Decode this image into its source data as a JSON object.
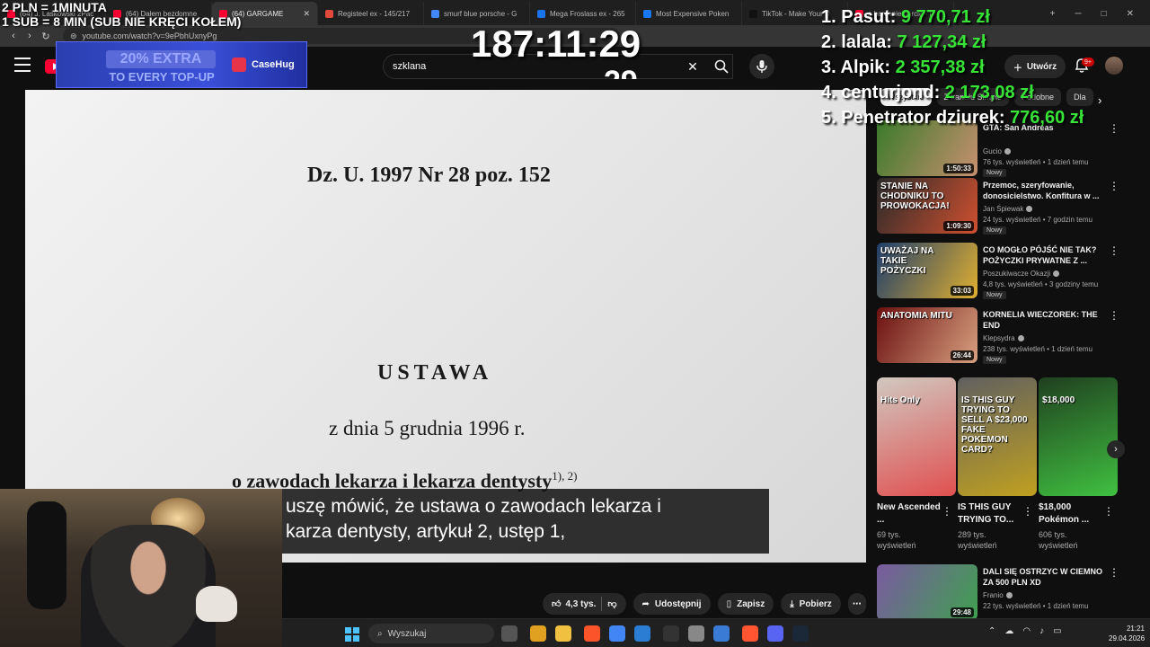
{
  "browser": {
    "tabs": [
      {
        "label": "(64) J. Laskowski 2Pac",
        "color": "#ff0033",
        "active": false
      },
      {
        "label": "(64) Dałem bezdomne",
        "color": "#ff0033",
        "active": false
      },
      {
        "label": "(64) GARGAME",
        "color": "#ff0033",
        "active": true
      },
      {
        "label": "Registeel ex - 145/217",
        "color": "#e04a3a",
        "active": false
      },
      {
        "label": "smurf blue porsche - G",
        "color": "#4285f4",
        "active": false
      },
      {
        "label": "Mega Froslass ex - 265",
        "color": "#1a73e8",
        "active": false
      },
      {
        "label": "Most Expensive Poken",
        "color": "#1877f2",
        "active": false
      },
      {
        "label": "TikTok - Make Your D",
        "color": "#111111",
        "active": false
      },
      {
        "label": "a barcenie garcie - (",
        "color": "#ff0033",
        "active": false
      }
    ],
    "url": "youtube.com/watch?v=9ePbhUxnyPg",
    "new_tab": "+"
  },
  "youtube": {
    "search_value": "szklana",
    "search_clear": "✕",
    "create_label": "Utwórz",
    "bell_badge": "9+",
    "chips": [
      {
        "label": "Wszystkie",
        "active": true
      },
      {
        "label": "Z kanału Simple",
        "active": false
      },
      {
        "label": "Podobne",
        "active": false
      },
      {
        "label": "Dla",
        "active": false
      }
    ],
    "chips_arrow": "›"
  },
  "ad": {
    "headline": "20% EXTRA",
    "subline": "TO EVERY TOP-UP",
    "brand": "CaseHug"
  },
  "video": {
    "document": {
      "reference": "Dz. U. 1997 Nr 28 poz. 152",
      "type": "USTAWA",
      "date": "z dnia 5 grudnia 1996 r.",
      "subject": "o zawodach lekarza i lekarza dentysty",
      "footnote": "1), 2)"
    },
    "subtitle_line1": "uszę mówić, że ustawa o zawodach lekarza i",
    "subtitle_line2": "karza dentysty, artykuł 2, ustęp 1,"
  },
  "actions": {
    "likes": "4,3 tys.",
    "share": "Udostępnij",
    "save": "Zapisz",
    "download": "Pobierz",
    "more": "⋯"
  },
  "overlay": {
    "rate_line1": "2 PLN = 1MINUTA",
    "rate_line2": "1 SUB = 8 MIN (SUB NIE KRĘCI KOŁEM)",
    "timer": "187:11:29",
    "timer_ghost": "29",
    "leaderboard": [
      {
        "name": "1. Pasut: ",
        "amount": "9 770,71 zł"
      },
      {
        "name": "2. lalala: ",
        "amount": "7 127,34 zł"
      },
      {
        "name": "3. Alpik: ",
        "amount": "2 357,38 zł"
      },
      {
        "name": "4. centurjond: ",
        "amount": "2 173,08 zł"
      },
      {
        "name": "5. Penetrator dziurek: ",
        "amount": "776,60 zł"
      }
    ]
  },
  "recommendations": [
    {
      "title": "GTA: San Andreas",
      "channel": "Gucio",
      "meta": "76 tys. wyświetleń • 1 dzień temu",
      "badge": "Nowy",
      "duration": "1:50:33",
      "thumb_a": "#3a7a2a",
      "thumb_b": "#c89070",
      "tag": ""
    },
    {
      "title": "Przemoc, szeryfowanie, donosicielstwo. Konfitura w ...",
      "channel": "Jan Śpiewak",
      "meta": "24 tys. wyświetleń • 7 godzin temu",
      "badge": "Nowy",
      "duration": "1:09:30",
      "thumb_a": "#2a2a2a",
      "thumb_b": "#d05030",
      "tag": "STANIE NA CHODNIKU TO PROWOKACJA!"
    },
    {
      "title": "CO MOGŁO PÓJŚĆ NIE TAK? POŻYCZKI PRYWATNE Z ...",
      "channel": "Poszukiwacze Okazji",
      "meta": "4,8 tys. wyświetleń • 3 godziny temu",
      "badge": "Nowy",
      "duration": "33:03",
      "thumb_a": "#1f3d6b",
      "thumb_b": "#e0b030",
      "tag": "UWAŻAJ NA TAKIE POŻYCZKI"
    },
    {
      "title": "KORNELIA WIECZOREK: THE END",
      "channel": "Klepsydra",
      "meta": "238 tys. wyświetleń • 1 dzień temu",
      "badge": "Nowy",
      "duration": "26:44",
      "thumb_a": "#6b1010",
      "thumb_b": "#d8a080",
      "tag": "ANATOMIA MITU"
    },
    {
      "title": "DALI SIĘ OSTRZYC W CIEMNO ZA 500 PLN XD",
      "channel": "Franio",
      "meta": "22 tys. wyświetleń • 1 dzień temu",
      "badge": "",
      "duration": "29:48",
      "thumb_a": "#7a5aa0",
      "thumb_b": "#40a050",
      "tag": ""
    }
  ],
  "shorts": [
    {
      "title": "New Ascended ...",
      "views": "69 tys. wyświetleń",
      "tag": "Hits Only",
      "thumb_a": "#d0c8c0",
      "thumb_b": "#e05050"
    },
    {
      "title": "IS THIS GUY TRYING TO...",
      "views": "289 tys. wyświetleń",
      "tag": "IS THIS GUY TRYING TO SELL A $23,000 FAKE POKEMON CARD?",
      "thumb_a": "#606060",
      "thumb_b": "#c0a020"
    },
    {
      "title": "$18,000 Pokémon ...",
      "views": "606 tys. wyświetleń",
      "tag": "$18,000",
      "thumb_a": "#204020",
      "thumb_b": "#40c040"
    }
  ],
  "shorts_next": "›",
  "taskbar": {
    "search_placeholder": "Wyszukaj",
    "time": "21:21",
    "date": "29.04.2026",
    "apps": [
      "#555555",
      "#e0a020",
      "#f0c040",
      "#fb542b",
      "#4285f4",
      "#2b7cd3",
      "#333333",
      "#888888",
      "#3a7bd5",
      "#ff5530",
      "#5865f2",
      "#1b2838"
    ]
  }
}
